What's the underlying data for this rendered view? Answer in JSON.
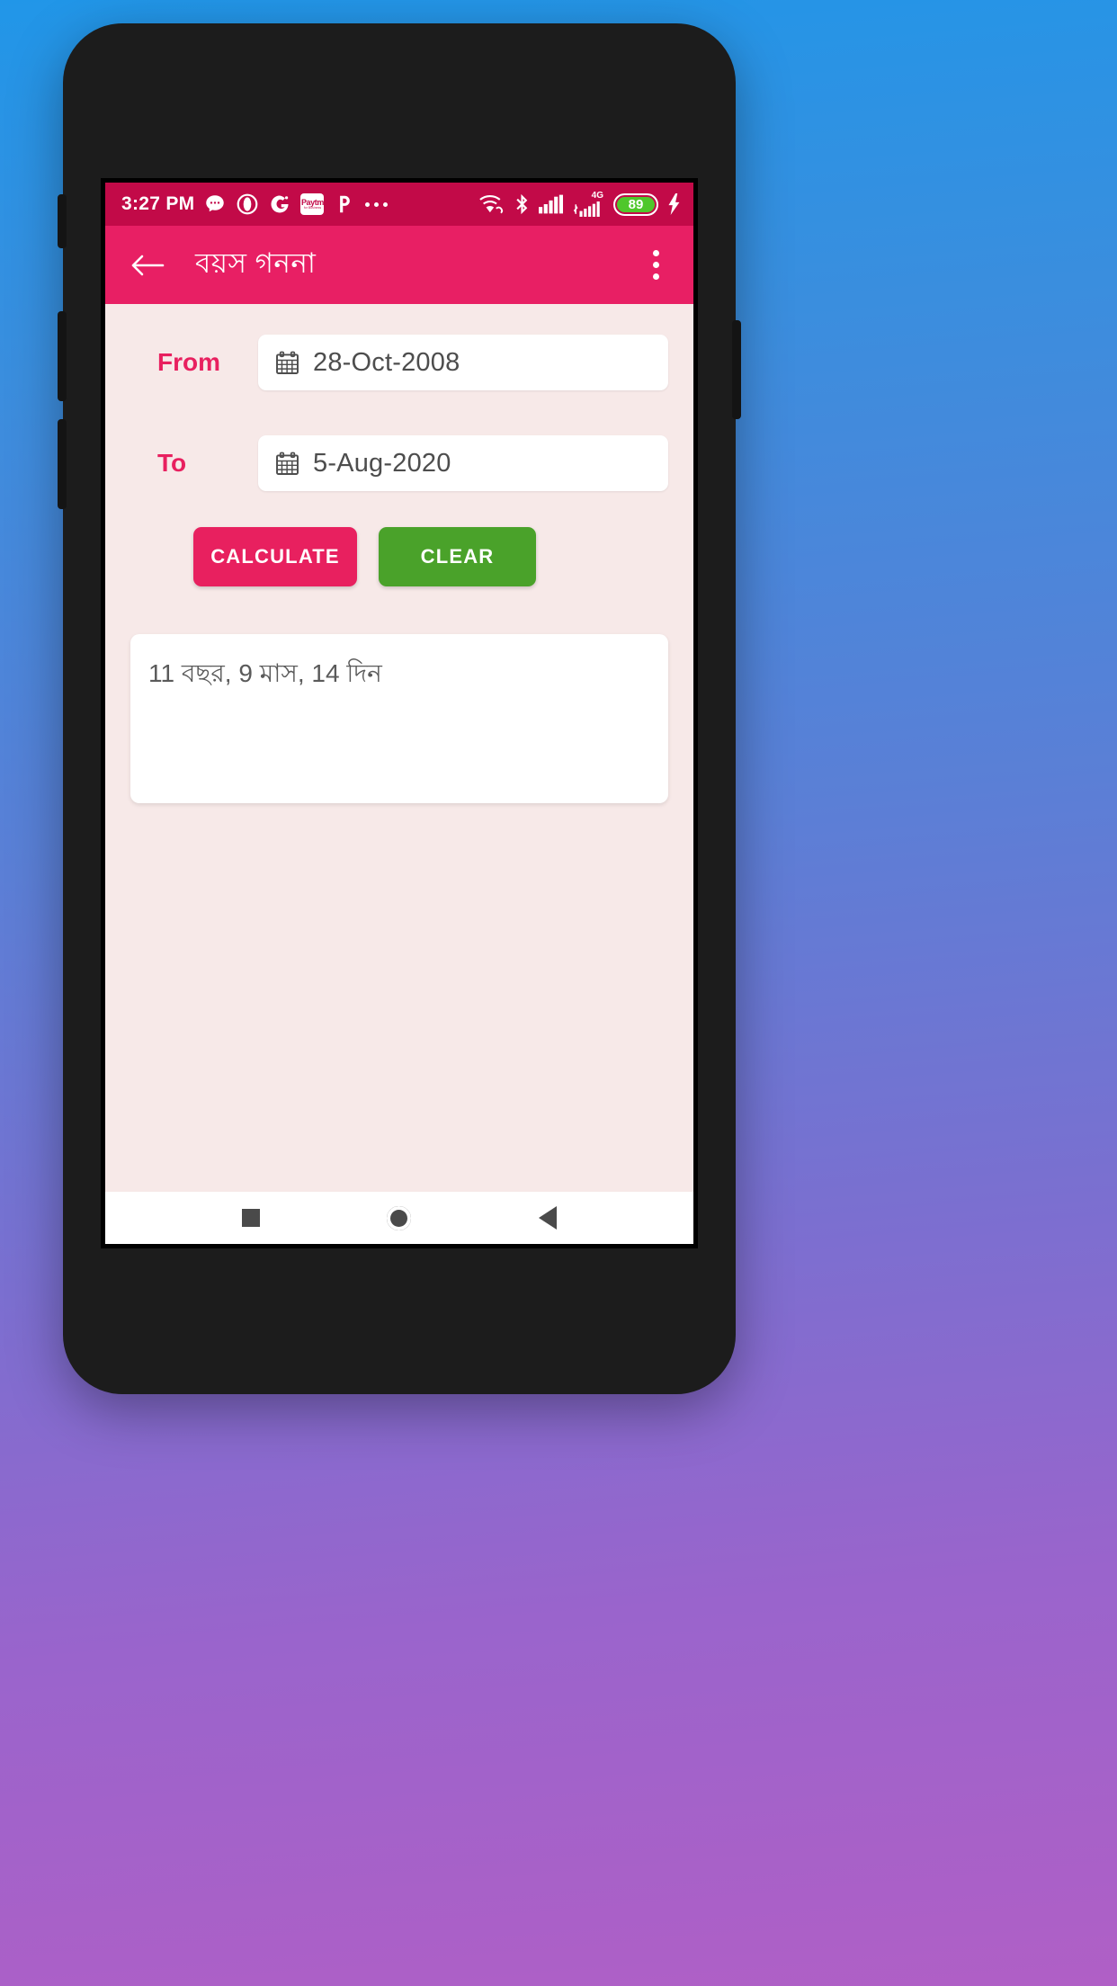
{
  "statusbar": {
    "time": "3:27 PM",
    "app_icons": [
      "message-icon",
      "opera-icon",
      "gaana-icon",
      "paytm-icon",
      "phonepe-icon",
      "more-dots-icon"
    ],
    "paytm_line1": "Paytm",
    "paytm_line2": "for Business",
    "network_label": "4G",
    "battery_level": "89",
    "right_icons": [
      "wifi-icon",
      "bluetooth-icon",
      "signal-icon",
      "signal-4g-icon",
      "battery-icon",
      "charging-icon"
    ]
  },
  "appbar": {
    "title": "বয়স গননা",
    "back_icon": "arrow-left-icon",
    "overflow_icon": "more-vertical-icon"
  },
  "form": {
    "from_label": "From",
    "from_date": "28-Oct-2008",
    "to_label": "To",
    "to_date": "5-Aug-2020",
    "calendar_icon": "calendar-icon"
  },
  "buttons": {
    "calculate": "CALCULATE",
    "clear": "CLEAR"
  },
  "result": {
    "text": "11 বছর, 9 মাস, 14 দিন"
  },
  "navbar": {
    "recents": "recents-square-icon",
    "home": "home-circle-icon",
    "back": "back-triangle-icon"
  },
  "colors": {
    "statusbar_bg": "#c20a48",
    "appbar_bg": "#e81f64",
    "accent_pink": "#e8205f",
    "clear_green": "#4aa22a",
    "content_bg": "#f7e9e8",
    "battery_green": "#4fc72b"
  }
}
